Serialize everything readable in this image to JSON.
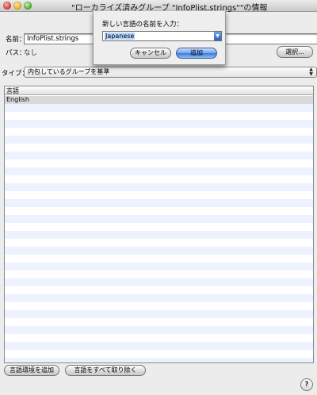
{
  "window": {
    "title": "\"ローカライズ済みグループ \"InfoPlist.strings\"\"の情報"
  },
  "form": {
    "name_label": "名前：",
    "name_value": "InfoPlist.strings",
    "path_label": "パス：",
    "path_value": "なし",
    "choose_button": "選択...",
    "type_label": "タイプ：",
    "type_value": "内包しているグループを基準"
  },
  "table": {
    "header": "言語",
    "rows": [
      "English"
    ]
  },
  "buttons": {
    "add_localization": "言語環境を追加",
    "remove_all": "言語をすべて取り除く",
    "help": "?"
  },
  "sheet": {
    "prompt": "新しい言語の名前を入力：",
    "language_value": "Japanese",
    "cancel": "キャンセル",
    "add": "追加"
  }
}
